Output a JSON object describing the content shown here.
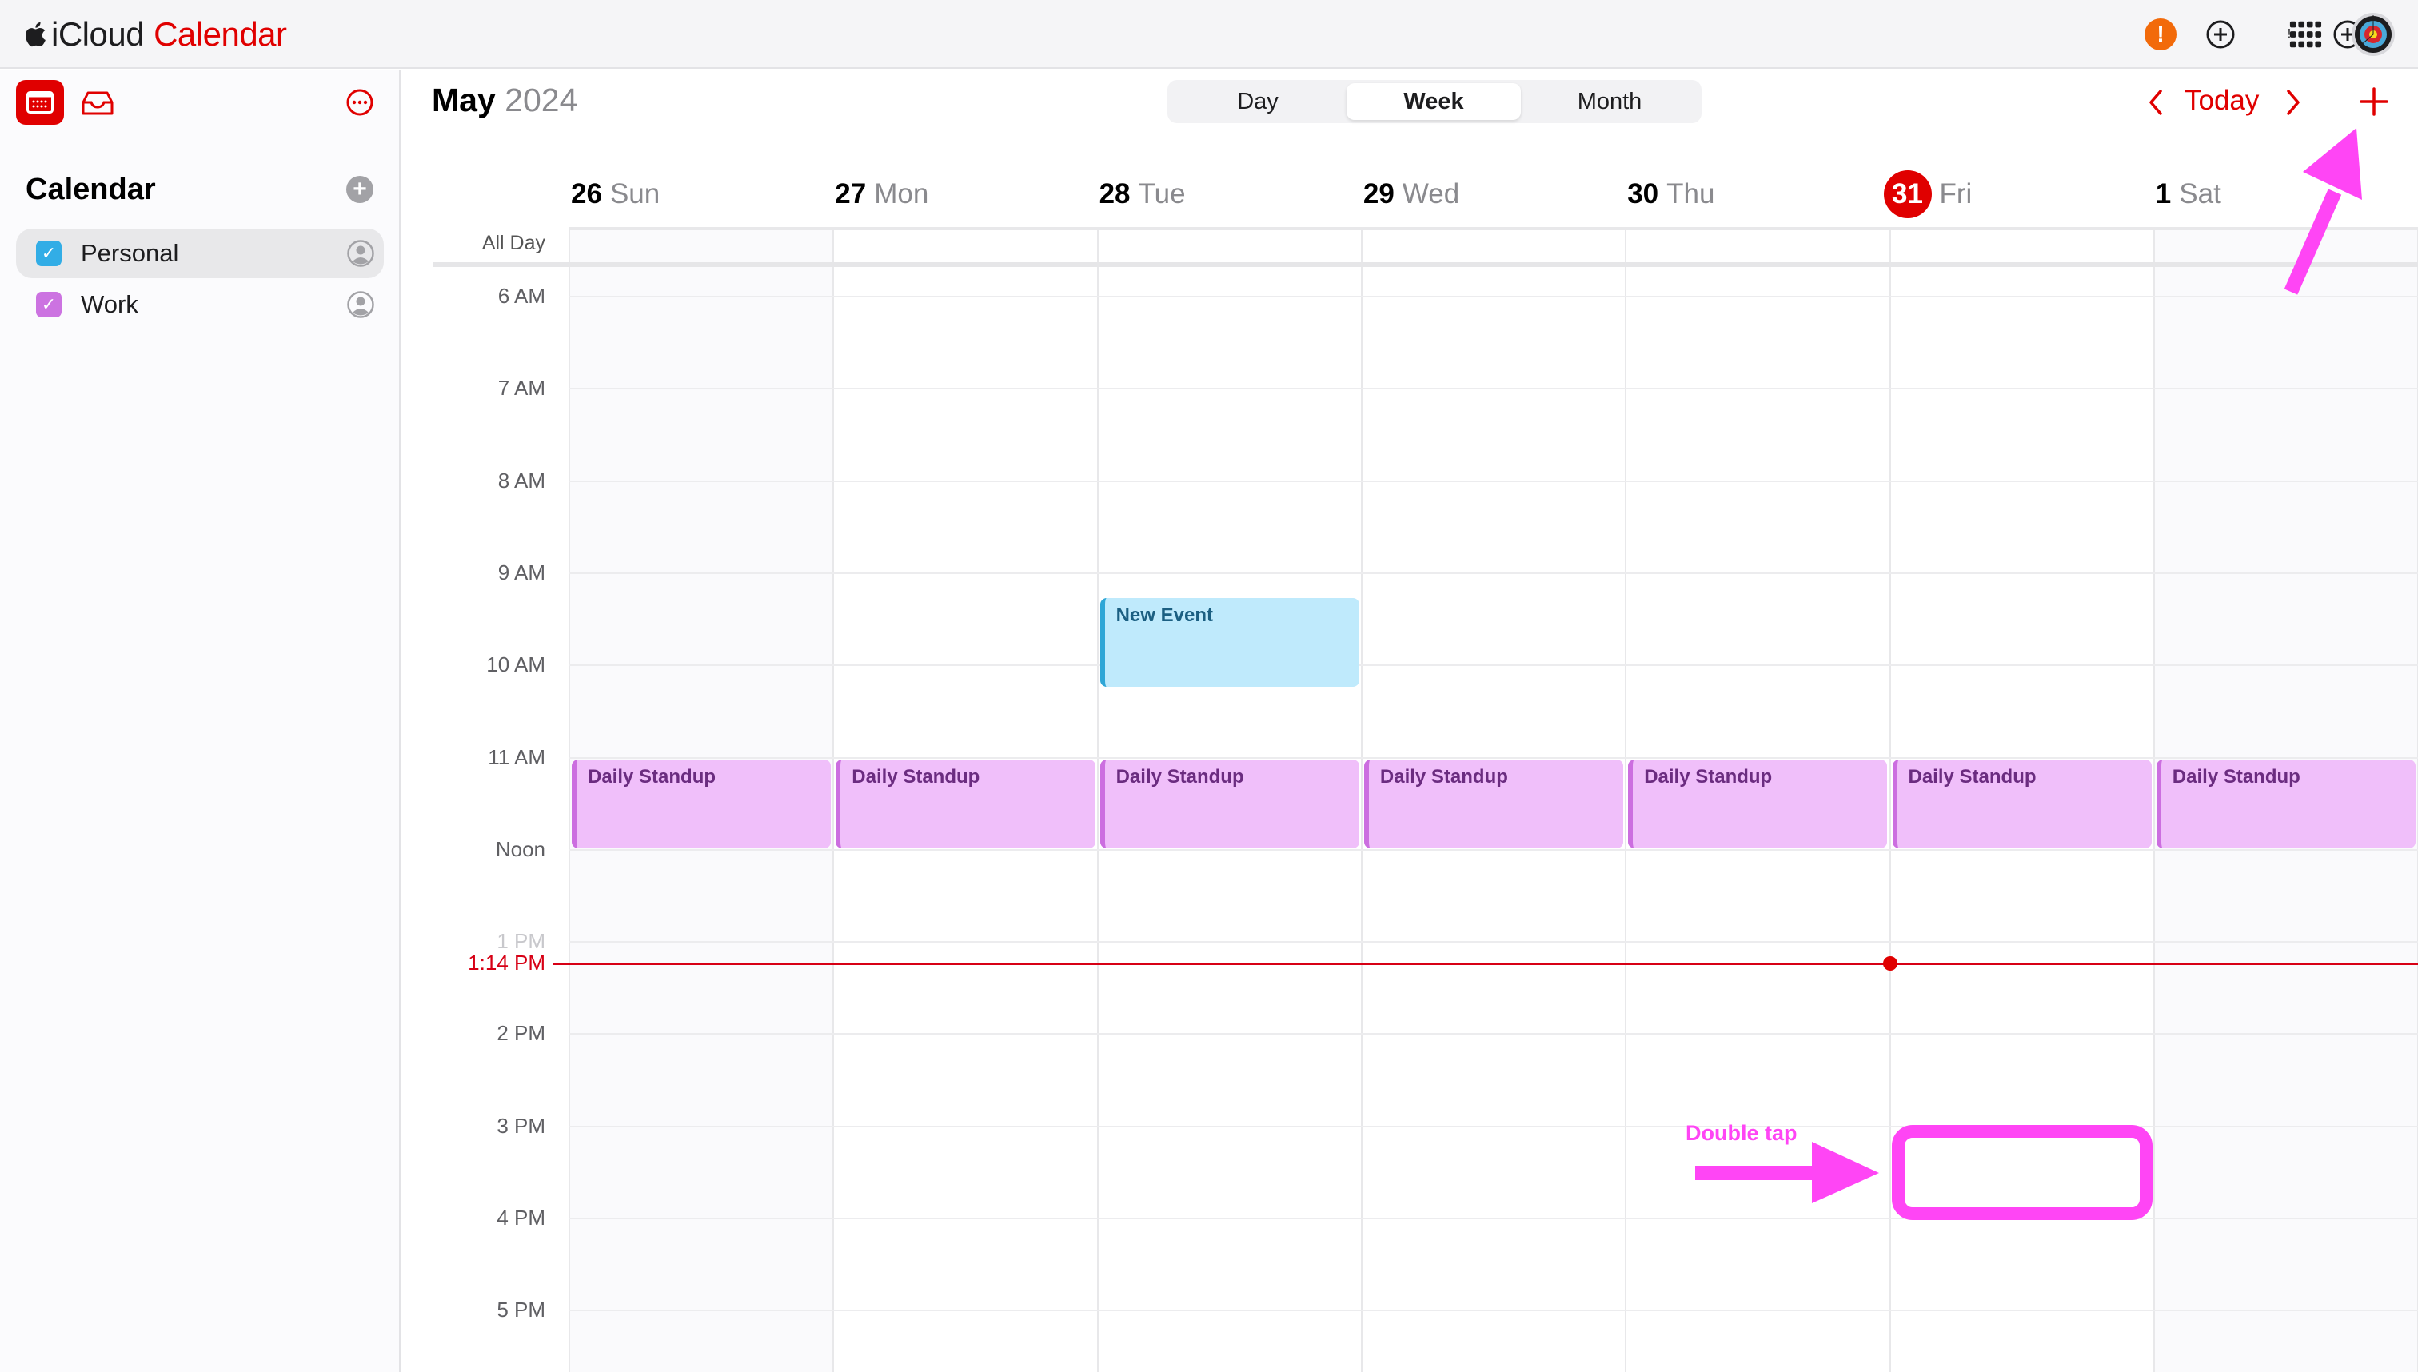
{
  "topbar": {
    "brand_prefix": "iCloud",
    "brand_app": "Calendar",
    "icons": [
      "apple-logo",
      "alert-icon",
      "add-circle-icon",
      "app-grid-icon",
      "avatar"
    ],
    "alert_glyph": "!"
  },
  "sidebar": {
    "title": "Calendar",
    "add_glyph": "+",
    "calendars": [
      {
        "label": "Personal",
        "checked": true,
        "color": "#32ade6",
        "selected": true
      },
      {
        "label": "Work",
        "checked": true,
        "color": "#cc73e1",
        "selected": false
      }
    ],
    "check_glyph": "✓"
  },
  "header": {
    "month": "May",
    "year": "2024",
    "views": [
      {
        "label": "Day",
        "active": false
      },
      {
        "label": "Week",
        "active": true
      },
      {
        "label": "Month",
        "active": false
      }
    ],
    "today_label": "Today"
  },
  "week": {
    "days": [
      {
        "num": "26",
        "weekday": "Sun",
        "today": false,
        "weekend": true
      },
      {
        "num": "27",
        "weekday": "Mon",
        "today": false,
        "weekend": false
      },
      {
        "num": "28",
        "weekday": "Tue",
        "today": false,
        "weekend": false
      },
      {
        "num": "29",
        "weekday": "Wed",
        "today": false,
        "weekend": false
      },
      {
        "num": "30",
        "weekday": "Thu",
        "today": false,
        "weekend": false
      },
      {
        "num": "31",
        "weekday": "Fri",
        "today": true,
        "weekend": false
      },
      {
        "num": "1",
        "weekday": "Sat",
        "today": false,
        "weekend": true
      }
    ],
    "all_day_label": "All Day",
    "hours": [
      "6 AM",
      "7 AM",
      "8 AM",
      "9 AM",
      "10 AM",
      "11 AM",
      "Noon",
      "1 PM",
      "2 PM",
      "3 PM",
      "4 PM",
      "5 PM"
    ],
    "now_label": "1:14 PM",
    "now_hour": 13.233
  },
  "events": [
    {
      "title": "New Event",
      "calendar": "personal",
      "day": 2,
      "start": 9.25,
      "end": 10.25
    },
    {
      "title": "Daily Standup",
      "calendar": "work",
      "day": 0,
      "start": 11,
      "end": 12
    },
    {
      "title": "Daily Standup",
      "calendar": "work",
      "day": 1,
      "start": 11,
      "end": 12
    },
    {
      "title": "Daily Standup",
      "calendar": "work",
      "day": 2,
      "start": 11,
      "end": 12
    },
    {
      "title": "Daily Standup",
      "calendar": "work",
      "day": 3,
      "start": 11,
      "end": 12
    },
    {
      "title": "Daily Standup",
      "calendar": "work",
      "day": 4,
      "start": 11,
      "end": 12
    },
    {
      "title": "Daily Standup",
      "calendar": "work",
      "day": 5,
      "start": 11,
      "end": 12
    },
    {
      "title": "Daily Standup",
      "calendar": "work",
      "day": 6,
      "start": 11,
      "end": 12
    }
  ],
  "annotations": {
    "double_tap_label": "Double tap",
    "color": "#ff45f5",
    "highlight_day": 5,
    "highlight_start": 15,
    "highlight_end": 16
  },
  "colors": {
    "accent": "#e00000",
    "personal": "#32ade6",
    "work": "#cc73e1"
  }
}
